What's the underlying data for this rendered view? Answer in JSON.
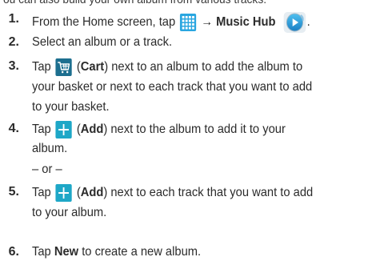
{
  "header_cutoff": "ou can also build your own album from various tracks:",
  "steps": [
    {
      "num": "1.",
      "pre": "From the Home screen, tap",
      "arrow": "→",
      "target": "Music Hub",
      "end": "."
    },
    {
      "num": "2.",
      "text": "Select an album or a track."
    },
    {
      "num": "3.",
      "tap": "Tap",
      "paren_open": "(",
      "label": "Cart",
      "paren_close": ")",
      "rest1": "next to an album to add the album to",
      "line2": "your basket or next to each track that you want to add",
      "line3": "to your basket."
    },
    {
      "num": "4.",
      "tap": "Tap",
      "paren_open": "(",
      "label": "Add",
      "paren_close": ")",
      "rest1": "next to the album to add it to your",
      "line2": "album."
    },
    {
      "or": "– or –"
    },
    {
      "num": "5.",
      "tap": "Tap",
      "paren_open": "(",
      "label": "Add",
      "paren_close": ")",
      "rest1": "next to each track that you want to add",
      "line2": "to your album."
    },
    {
      "num": "6.",
      "tap": "Tap",
      "label": "New",
      "rest1": "to create a new album."
    }
  ],
  "icons": {
    "apps_grid": "apps-grid-icon",
    "music_hub": "music-hub-icon",
    "cart": "cart-icon",
    "add": "add-icon"
  }
}
